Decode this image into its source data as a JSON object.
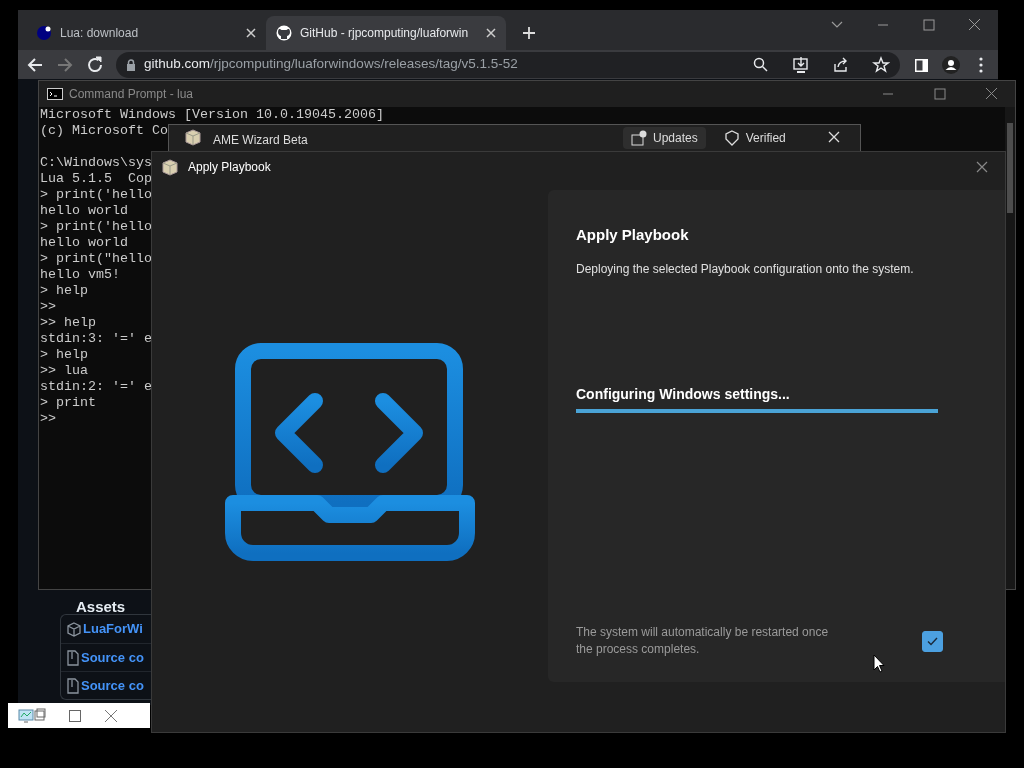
{
  "browser": {
    "tabs": [
      {
        "title": "Lua: download",
        "selected": false
      },
      {
        "title": "GitHub - rjpcomputing/luaforwin",
        "selected": true
      }
    ],
    "address": {
      "host": "github.com",
      "path": "/rjpcomputing/luaforwindows/releases/tag/v5.1.5-52"
    },
    "page": {
      "section_heading": "Assets",
      "assets": [
        {
          "kind": "package",
          "name": "LuaForWi"
        },
        {
          "kind": "zip",
          "name": "Source co"
        },
        {
          "kind": "zip",
          "name": "Source co"
        }
      ]
    }
  },
  "console": {
    "title": "Command Prompt - lua",
    "blocks": [
      [
        "Microsoft Windows [Version 10.0.19045.2006]",
        "(c) Microsoft Co"
      ],
      [
        "C:\\Windows\\sys",
        "Lua 5.1.5  Cop",
        "> print('hello",
        "hello world",
        "> print('hello",
        "hello world",
        "> print(\"hello",
        "hello vm5!",
        "> help",
        ">>",
        ">> help",
        "stdin:3: '=' e",
        "> help",
        ">> lua",
        "stdin:2: '=' e",
        "> print",
        ">>"
      ]
    ]
  },
  "wizard": {
    "title": "AME Wizard Beta",
    "tabs": [
      {
        "label": "Updates",
        "selected": true
      },
      {
        "label": "Verified",
        "selected": false
      }
    ]
  },
  "dialog": {
    "title": "Apply Playbook",
    "heading": "Apply Playbook",
    "description": "Deploying the selected Playbook configuration onto the system.",
    "step": "Configuring Windows settings...",
    "level": 1,
    "note": "The system will automatically be restarted once the process completes.",
    "restart_checked": true
  }
}
